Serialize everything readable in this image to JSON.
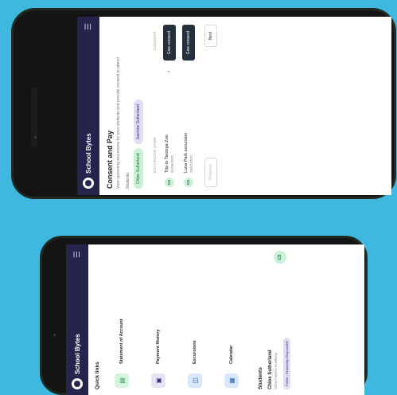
{
  "app": {
    "brand": "School Bytes",
    "menu_icon": "hamburger-icon"
  },
  "consent": {
    "title": "Consent and Pay",
    "description": "View upcoming excursions for your students and provide consent to attend.",
    "students_label": "Students:",
    "students": [
      "Chloe Sutherland",
      "Jasmine Sutherland"
    ],
    "columns": {
      "name": "EXCURSION NAME",
      "consent": "CONSENT"
    },
    "rows": [
      {
        "initials": "CS",
        "name": "Trip to Taronga Zoo",
        "date": "01/06/2022",
        "action": "Give consent"
      },
      {
        "initials": "CS",
        "name": "Luna Park excursion",
        "date": "26/07/2022",
        "action": "Give consent"
      }
    ],
    "previous_label": "Previous",
    "next_label": "Next"
  },
  "home": {
    "quick_links_title": "Quick links",
    "quick_links": [
      {
        "label": "Statement of Account",
        "icon": "document-icon",
        "bg": "#d6f5e0",
        "fg": "#2b8a52"
      },
      {
        "label": "Payment History",
        "icon": "book-icon",
        "bg": "#e6e3f6",
        "fg": "#3b2d77"
      },
      {
        "label": "Excursions",
        "icon": "bus-icon",
        "bg": "#d8e8fb",
        "fg": "#2a5fb0"
      },
      {
        "label": "Calendar",
        "icon": "calendar-icon",
        "bg": "#d8e8fb",
        "fg": "#2a5fb0"
      }
    ],
    "students_title": "Students",
    "student": {
      "name": "Chloe Sutherland",
      "school": "School Bytes Academy",
      "role": "Father - Financially Responsible",
      "initials": "CS"
    }
  }
}
